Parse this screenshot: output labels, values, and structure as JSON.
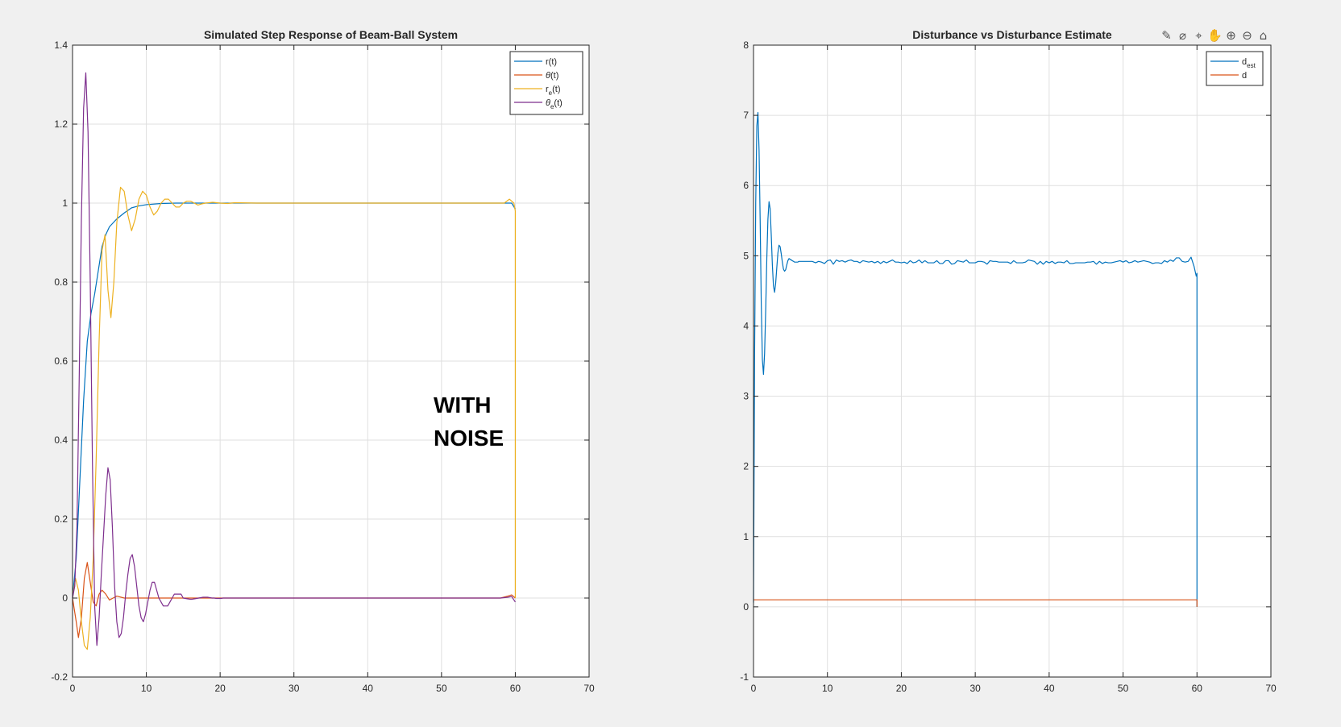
{
  "chart_data": [
    {
      "type": "line",
      "title": "Simulated Step Response of Beam-Ball System",
      "xlabel": "",
      "ylabel": "",
      "xlim": [
        0,
        70
      ],
      "ylim": [
        -0.2,
        1.4
      ],
      "xticks": [
        0,
        10,
        20,
        30,
        40,
        50,
        60,
        70
      ],
      "xtick_labels": [
        "0",
        "10",
        "20",
        "30",
        "40",
        "50",
        "60",
        "70"
      ],
      "yticks": [
        -0.2,
        0,
        0.2,
        0.4,
        0.6,
        0.8,
        1,
        1.2,
        1.4
      ],
      "ytick_labels": [
        "-0.2",
        "0",
        "0.2",
        "0.4",
        "0.6",
        "0.8",
        "1",
        "1.2",
        "1.4"
      ],
      "grid": true,
      "legend_position": "top-right",
      "annotation": [
        "WITH",
        "NOISE"
      ],
      "series": [
        {
          "name": "r(t)",
          "legend_main": "r",
          "legend_sub": "",
          "legend_suffix": "(t)",
          "greek": false,
          "color": "#0072BD",
          "x": [
            0,
            0.5,
            1,
            1.5,
            2,
            2.5,
            3,
            3.5,
            4,
            4.5,
            5,
            6,
            7,
            8,
            9,
            10,
            12,
            14,
            16,
            20,
            30,
            40,
            50,
            57,
            59,
            59.5,
            60
          ],
          "y": [
            0,
            0.1,
            0.3,
            0.5,
            0.65,
            0.72,
            0.77,
            0.83,
            0.89,
            0.92,
            0.94,
            0.96,
            0.975,
            0.988,
            0.993,
            0.996,
            0.999,
            1.0,
            1.0,
            1.0,
            1.0,
            1.0,
            1.0,
            1.0,
            1.0,
            1.0,
            0.985
          ]
        },
        {
          "name": "θ(t)",
          "legend_main": "θ",
          "legend_sub": "",
          "legend_suffix": "(t)",
          "greek": true,
          "color": "#D95319",
          "x": [
            0,
            0.5,
            0.8,
            1.2,
            1.6,
            2.0,
            2.4,
            2.8,
            3.2,
            3.6,
            4.0,
            4.5,
            5,
            5.5,
            6,
            7,
            8,
            10,
            12,
            20,
            40,
            58,
            59,
            59.5,
            60
          ],
          "y": [
            0,
            -0.06,
            -0.1,
            -0.05,
            0.05,
            0.09,
            0.04,
            -0.01,
            -0.02,
            0.01,
            0.02,
            0.01,
            -0.005,
            0,
            0.005,
            0,
            0,
            0,
            0,
            0,
            0,
            0,
            0.005,
            0.008,
            0
          ]
        },
        {
          "name": "re(t)",
          "legend_main": "r",
          "legend_sub": "e",
          "legend_suffix": "(t)",
          "greek": false,
          "color": "#EDB120",
          "x": [
            0,
            0.4,
            0.8,
            1.2,
            1.6,
            2.0,
            2.4,
            2.8,
            3.2,
            3.6,
            4.0,
            4.4,
            4.8,
            5.2,
            5.6,
            6.0,
            6.5,
            7.0,
            7.5,
            8.0,
            8.5,
            9.0,
            9.5,
            10.0,
            10.5,
            11.0,
            11.5,
            12.0,
            12.5,
            13.0,
            13.5,
            14.0,
            14.5,
            15.0,
            15.5,
            16.0,
            16.5,
            17.0,
            17.5,
            18.0,
            19.0,
            20.0,
            21.0,
            22.0,
            25.0,
            30.0,
            40.0,
            50.0,
            57.0,
            58.5,
            59.2,
            59.8,
            60.0,
            60.0
          ],
          "y": [
            0.0,
            0.05,
            0.02,
            -0.06,
            -0.12,
            -0.13,
            -0.05,
            0.1,
            0.35,
            0.65,
            0.88,
            0.92,
            0.78,
            0.71,
            0.8,
            0.95,
            1.04,
            1.03,
            0.97,
            0.93,
            0.96,
            1.01,
            1.03,
            1.02,
            0.99,
            0.97,
            0.98,
            1.0,
            1.01,
            1.01,
            1.0,
            0.99,
            0.99,
            1.0,
            1.005,
            1.005,
            1.0,
            0.995,
            0.998,
            1.0,
            1.002,
            1.0,
            0.999,
            1.001,
            1.0,
            1.0,
            1.0,
            1.0,
            1.0,
            1.0,
            1.01,
            1.0,
            0.98,
            0.0
          ]
        },
        {
          "name": "θe(t)",
          "legend_main": "θ",
          "legend_sub": "e",
          "legend_suffix": "(t)",
          "greek": true,
          "color": "#7E2F8E",
          "x": [
            0,
            0.3,
            0.6,
            0.9,
            1.2,
            1.5,
            1.8,
            2.1,
            2.4,
            2.7,
            3.0,
            3.3,
            3.6,
            3.9,
            4.2,
            4.5,
            4.8,
            5.1,
            5.4,
            5.7,
            6.0,
            6.3,
            6.6,
            6.9,
            7.2,
            7.5,
            7.8,
            8.1,
            8.4,
            8.7,
            9.0,
            9.3,
            9.6,
            9.9,
            10.2,
            10.5,
            10.8,
            11.1,
            11.4,
            11.7,
            12.0,
            12.3,
            12.6,
            12.9,
            13.2,
            13.5,
            13.8,
            14.1,
            14.4,
            14.7,
            15.0,
            15.3,
            15.6,
            15.9,
            16.2,
            16.5,
            16.8,
            17.1,
            17.4,
            17.7,
            18.0,
            18.3,
            18.6,
            18.9,
            19.2,
            19.5,
            19.8,
            20.1,
            20.4,
            20.7,
            21.0,
            21.3,
            21.6,
            21.9,
            22.2,
            22.5,
            22.8,
            23.1,
            23.4,
            23.7,
            24.0,
            24.3,
            24.6,
            24.9,
            25.2,
            25.5,
            25.8,
            26.1,
            26.4,
            26.7,
            27.0,
            27.3,
            27.6,
            27.9,
            28.2,
            28.5,
            28.8,
            29.1,
            29.4,
            29.7,
            30.0,
            40.0,
            50.0,
            57.0,
            58.0,
            59.0,
            59.5,
            60.0
          ],
          "y": [
            0.0,
            0.03,
            0.18,
            0.55,
            0.96,
            1.24,
            1.33,
            1.18,
            0.8,
            0.34,
            -0.02,
            -0.12,
            -0.05,
            0.06,
            0.16,
            0.26,
            0.33,
            0.3,
            0.18,
            0.03,
            -0.06,
            -0.1,
            -0.09,
            -0.05,
            0.01,
            0.06,
            0.1,
            0.11,
            0.08,
            0.03,
            -0.02,
            -0.05,
            -0.06,
            -0.04,
            -0.01,
            0.02,
            0.04,
            0.04,
            0.02,
            0.0,
            -0.01,
            -0.02,
            -0.02,
            -0.02,
            -0.01,
            0.0,
            0.01,
            0.01,
            0.01,
            0.01,
            0.0,
            -0.001,
            -0.002,
            -0.003,
            -0.003,
            -0.002,
            -0.001,
            0.0,
            0.001,
            0.002,
            0.002,
            0.002,
            0.001,
            0.0,
            -0.0,
            -0.001,
            -0.001,
            -0.001,
            -0.0,
            -0.0,
            0.0,
            0.0,
            0.0,
            0.0,
            0.0,
            0.0,
            0.0,
            -0.0,
            -0.0,
            -0.0,
            -0.0,
            -0.0,
            -0.0,
            0.0,
            0.0,
            0.0,
            0.0,
            0.0,
            0.0,
            0.0,
            0.0,
            -0.0,
            -0.0,
            -0.0,
            -0.0,
            -0.0,
            -0.0,
            -0.0,
            0.0,
            0.0,
            0.0,
            0.0,
            0.0,
            0.0,
            0.0,
            0.002,
            0.004,
            -0.01
          ]
        }
      ]
    },
    {
      "type": "line",
      "title": "Disturbance vs Disturbance Estimate",
      "xlabel": "",
      "ylabel": "",
      "xlim": [
        0,
        70
      ],
      "ylim": [
        -1,
        8
      ],
      "xticks": [
        0,
        10,
        20,
        30,
        40,
        50,
        60,
        70
      ],
      "xtick_labels": [
        "0",
        "10",
        "20",
        "30",
        "40",
        "50",
        "60",
        "70"
      ],
      "yticks": [
        -1,
        0,
        1,
        2,
        3,
        4,
        5,
        6,
        7,
        8
      ],
      "ytick_labels": [
        "-1",
        "0",
        "1",
        "2",
        "3",
        "4",
        "5",
        "6",
        "7",
        "8"
      ],
      "grid": true,
      "legend_position": "top-right",
      "series": [
        {
          "name": "dest",
          "legend_main": "d",
          "legend_sub": "est",
          "legend_suffix": "",
          "greek": false,
          "color": "#0072BD",
          "x": [
            0.0,
            0.15,
            0.3,
            0.45,
            0.6,
            0.75,
            0.9,
            1.05,
            1.2,
            1.35,
            1.5,
            1.65,
            1.8,
            1.95,
            2.1,
            2.25,
            2.4,
            2.55,
            2.7,
            2.85,
            3.0,
            3.15,
            3.3,
            3.45,
            3.6,
            3.75,
            3.9,
            4.05,
            4.2,
            4.35,
            4.5,
            4.65,
            4.8,
            4.95,
            5.1,
            5.25,
            5.4,
            5.55,
            5.7,
            5.85,
            6.0,
            6.15,
            6.3,
            6.45,
            6.6,
            6.75,
            6.9,
            7.05,
            7.2,
            7.35,
            7.5,
            7.65,
            7.8,
            7.95,
            8.4,
            8.8,
            9.2,
            9.6,
            10.0,
            10.4,
            10.8,
            11.2,
            11.6,
            12.0,
            12.4,
            12.8,
            13.2,
            13.6,
            14.0,
            14.4,
            14.8,
            15.2,
            15.6,
            16.0,
            16.4,
            16.8,
            17.2,
            17.6,
            18.0,
            18.4,
            18.8,
            19.2,
            19.6,
            20.0,
            20.4,
            20.8,
            21.2,
            21.6,
            22.0,
            22.4,
            22.8,
            23.2,
            23.6,
            24.0,
            24.4,
            24.8,
            25.2,
            25.6,
            26.0,
            26.4,
            26.8,
            27.2,
            27.6,
            28.0,
            28.4,
            28.8,
            29.2,
            29.6,
            30.0,
            30.4,
            30.8,
            31.2,
            31.6,
            32.0,
            32.4,
            32.8,
            33.2,
            33.6,
            34.0,
            34.4,
            34.8,
            35.2,
            35.6,
            36.0,
            36.4,
            36.8,
            37.2,
            37.6,
            38.0,
            38.4,
            38.8,
            39.2,
            39.6,
            40.0,
            40.4,
            40.8,
            41.2,
            41.6,
            42.0,
            42.4,
            42.8,
            43.2,
            43.6,
            44.0,
            44.4,
            44.8,
            45.2,
            45.6,
            46.0,
            46.4,
            46.8,
            47.2,
            47.6,
            48.0,
            48.4,
            48.8,
            49.2,
            49.6,
            50.0,
            50.4,
            50.8,
            51.2,
            51.6,
            52.0,
            52.4,
            52.8,
            53.2,
            53.6,
            54.0,
            54.4,
            54.8,
            55.2,
            55.6,
            56.0,
            56.4,
            56.8,
            57.2,
            57.6,
            58.0,
            58.4,
            58.8,
            59.2,
            59.6,
            59.9,
            60.0,
            60.0
          ],
          "y": [
            0.06,
            3.62,
            5.76,
            6.85,
            7.04,
            6.51,
            5.5,
            4.32,
            3.52,
            3.31,
            3.61,
            4.23,
            4.96,
            5.52,
            5.77,
            5.67,
            5.3,
            4.87,
            4.57,
            4.48,
            4.61,
            4.83,
            5.04,
            5.15,
            5.13,
            5.03,
            4.91,
            4.81,
            4.78,
            4.8,
            4.87,
            4.93,
            4.96,
            4.95,
            4.94,
            4.93,
            4.92,
            4.91,
            4.91,
            4.91,
            4.91,
            4.92,
            4.92,
            4.92,
            4.92,
            4.92,
            4.92,
            4.92,
            4.92,
            4.92,
            4.92,
            4.92,
            4.92,
            4.92,
            4.9,
            4.92,
            4.91,
            4.89,
            4.93,
            4.94,
            4.88,
            4.94,
            4.92,
            4.93,
            4.91,
            4.93,
            4.94,
            4.92,
            4.92,
            4.9,
            4.93,
            4.92,
            4.91,
            4.92,
            4.9,
            4.92,
            4.89,
            4.92,
            4.9,
            4.92,
            4.94,
            4.91,
            4.91,
            4.9,
            4.91,
            4.89,
            4.93,
            4.9,
            4.91,
            4.94,
            4.9,
            4.93,
            4.9,
            4.9,
            4.9,
            4.93,
            4.89,
            4.89,
            4.93,
            4.93,
            4.88,
            4.89,
            4.93,
            4.92,
            4.91,
            4.94,
            4.9,
            4.9,
            4.9,
            4.92,
            4.92,
            4.91,
            4.88,
            4.93,
            4.92,
            4.92,
            4.91,
            4.91,
            4.91,
            4.91,
            4.89,
            4.93,
            4.9,
            4.9,
            4.9,
            4.91,
            4.94,
            4.93,
            4.92,
            4.88,
            4.92,
            4.88,
            4.92,
            4.9,
            4.92,
            4.89,
            4.91,
            4.91,
            4.9,
            4.93,
            4.89,
            4.89,
            4.9,
            4.9,
            4.9,
            4.9,
            4.91,
            4.91,
            4.92,
            4.88,
            4.92,
            4.89,
            4.91,
            4.9,
            4.9,
            4.91,
            4.92,
            4.93,
            4.91,
            4.93,
            4.9,
            4.91,
            4.93,
            4.91,
            4.92,
            4.93,
            4.92,
            4.91,
            4.89,
            4.9,
            4.9,
            4.89,
            4.93,
            4.91,
            4.94,
            4.92,
            4.97,
            4.97,
            4.92,
            4.91,
            4.92,
            4.98,
            4.85,
            4.71,
            4.75,
            0.0
          ]
        },
        {
          "name": "d",
          "legend_main": "d",
          "legend_sub": "",
          "legend_suffix": "",
          "greek": false,
          "color": "#D95319",
          "x": [
            0,
            60,
            60
          ],
          "y": [
            0.1,
            0.1,
            0.0
          ]
        }
      ]
    }
  ],
  "toolbar": {
    "buttons": [
      {
        "name": "edit-plot-icon",
        "glyph": "✎"
      },
      {
        "name": "brush-icon",
        "glyph": "⌀"
      },
      {
        "name": "data-cursor-icon",
        "glyph": "⌖"
      },
      {
        "name": "pan-icon",
        "glyph": "✋"
      },
      {
        "name": "zoom-in-icon",
        "glyph": "⊕"
      },
      {
        "name": "zoom-out-icon",
        "glyph": "⊖"
      },
      {
        "name": "home-icon",
        "glyph": "⌂"
      }
    ]
  }
}
